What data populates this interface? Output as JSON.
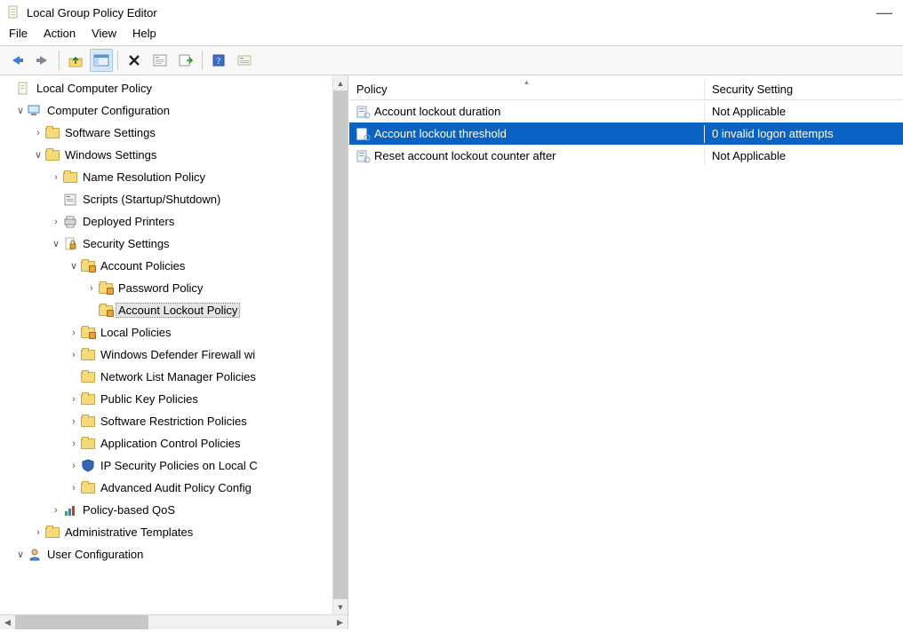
{
  "window": {
    "title": "Local Group Policy Editor"
  },
  "menubar": {
    "file": "File",
    "action": "Action",
    "view": "View",
    "help": "Help"
  },
  "tree": {
    "root": "Local Computer Policy",
    "comp_config": "Computer Configuration",
    "software_settings": "Software Settings",
    "windows_settings": "Windows Settings",
    "name_resolution": "Name Resolution Policy",
    "scripts": "Scripts (Startup/Shutdown)",
    "deployed_printers": "Deployed Printers",
    "security_settings": "Security Settings",
    "account_policies": "Account Policies",
    "password_policy": "Password Policy",
    "account_lockout_policy": "Account Lockout Policy",
    "local_policies": "Local Policies",
    "windows_defender_firewall": "Windows Defender Firewall wi",
    "network_list_manager": "Network List Manager Policies",
    "public_key": "Public Key Policies",
    "software_restriction": "Software Restriction Policies",
    "app_control": "Application Control Policies",
    "ip_security": "IP Security Policies on Local C",
    "advanced_audit": "Advanced Audit Policy Config",
    "policy_based_qos": "Policy-based QoS",
    "admin_templates": "Administrative Templates",
    "user_config": "User Configuration"
  },
  "list": {
    "header_policy": "Policy",
    "header_setting": "Security Setting",
    "rows": [
      {
        "policy": "Account lockout duration",
        "setting": "Not Applicable"
      },
      {
        "policy": "Account lockout threshold",
        "setting": "0 invalid logon attempts"
      },
      {
        "policy": "Reset account lockout counter after",
        "setting": "Not Applicable"
      }
    ]
  }
}
